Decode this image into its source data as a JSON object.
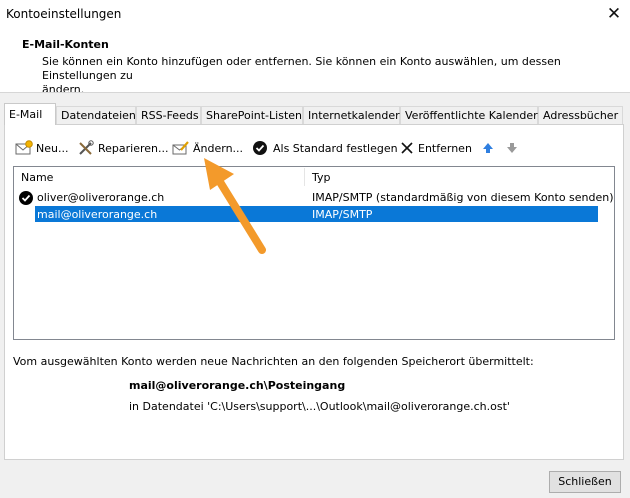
{
  "window": {
    "title": "Kontoeinstellungen"
  },
  "header": {
    "section_title": "E-Mail-Konten",
    "description_line1": "Sie können ein Konto hinzufügen oder entfernen. Sie können ein Konto auswählen, um dessen Einstellungen zu",
    "description_line2": "ändern."
  },
  "tabs": [
    {
      "label": "E-Mail",
      "active": true
    },
    {
      "label": "Datendateien"
    },
    {
      "label": "RSS-Feeds"
    },
    {
      "label": "SharePoint-Listen"
    },
    {
      "label": "Internetkalender"
    },
    {
      "label": "Veröffentlichte Kalender"
    },
    {
      "label": "Adressbücher"
    }
  ],
  "toolbar": {
    "new_label": "Neu...",
    "repair_label": "Reparieren...",
    "change_label": "Ändern...",
    "default_label": "Als Standard festlegen",
    "remove_label": "Entfernen"
  },
  "accounts_table": {
    "columns": [
      "Name",
      "Typ"
    ],
    "rows": [
      {
        "name": "oliver@oliverorange.ch",
        "type": "IMAP/SMTP (standardmäßig von diesem Konto senden)",
        "is_default": true,
        "selected": false
      },
      {
        "name": "mail@oliverorange.ch",
        "type": "IMAP/SMTP",
        "is_default": false,
        "selected": true
      }
    ]
  },
  "delivery_info": {
    "text": "Vom ausgewählten Konto werden neue Nachrichten an den folgenden Speicherort übermittelt:",
    "location": "mail@oliverorange.ch\\Posteingang",
    "datafile": "in Datendatei 'C:\\Users\\support\\...\\Outlook\\mail@oliverorange.ch.ost'"
  },
  "footer": {
    "close_label": "Schließen"
  },
  "colors": {
    "selection": "#0a78d7",
    "annotation_arrow": "#f39a2b"
  }
}
